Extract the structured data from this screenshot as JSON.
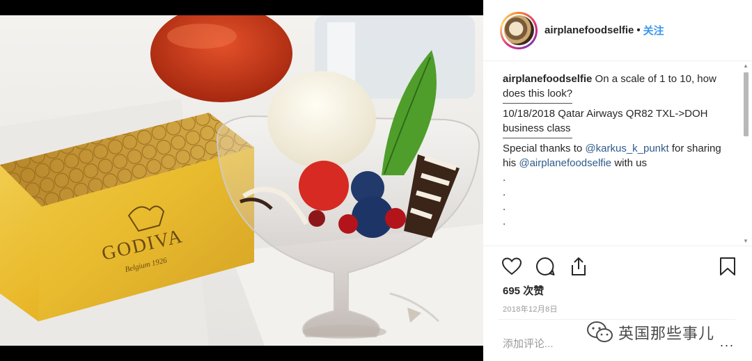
{
  "post": {
    "username": "airplanefoodselfie",
    "separator": "•",
    "follow_label": "关注",
    "caption": {
      "username": "airplanefoodselfie",
      "line1": "On a scale of 1 to 10, how does this look?",
      "line2": "10/18/2018 Qatar Airways QR82 TXL->DOH business class",
      "thanks_prefix": "Special thanks to ",
      "mention1": "@karkus_k_punkt",
      "thanks_middle": " for sharing his ",
      "mention2": "@airplanefoodselfie",
      "thanks_suffix": " with us",
      "dots": [
        ".",
        ".",
        ".",
        "."
      ]
    },
    "likes": "695 次赞",
    "date": "2018年12月8日",
    "comment_placeholder": "添加评论...",
    "more": "...",
    "watermark": "英国那些事儿"
  },
  "photo": {
    "brand_text": "GODIVA",
    "brand_subtext": "Belgium 1926"
  },
  "icons": [
    "heart-icon",
    "comment-icon",
    "share-icon",
    "bookmark-icon",
    "wechat-icon"
  ],
  "colors": {
    "follow": "#3897f0",
    "text": "#262626",
    "muted": "#999999"
  }
}
